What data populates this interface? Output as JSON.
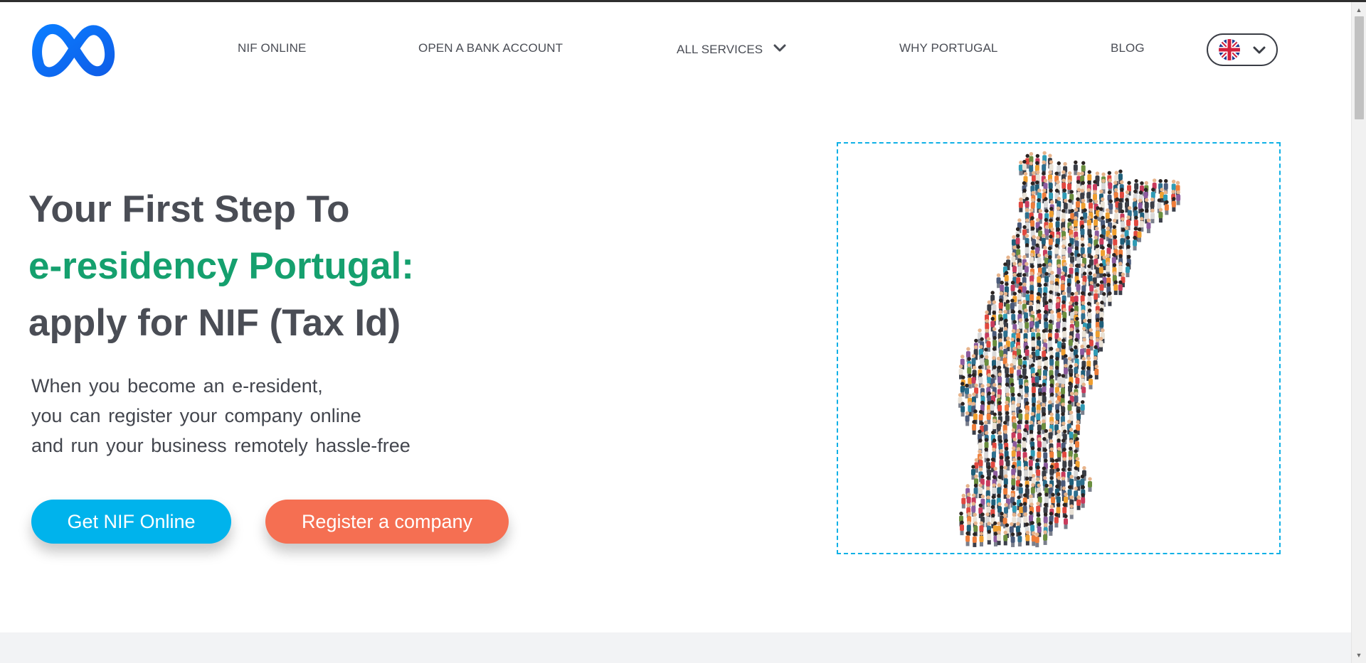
{
  "header": {
    "logo_icon": "meta-infinity-logo",
    "nav": [
      {
        "label": "NIF ONLINE"
      },
      {
        "label": "OPEN A BANK ACCOUNT"
      },
      {
        "label": "ALL SERVICES",
        "icon": "chevron-down-icon"
      },
      {
        "label": "WHY PORTUGAL"
      },
      {
        "label": "BLOG"
      }
    ],
    "language": {
      "icon": "uk-flag-icon",
      "selected": "EN"
    }
  },
  "hero": {
    "title_line1": "Your First Step To",
    "title_line2": "e-residency Portugal:",
    "title_line3": "apply for NIF (Tax Id)",
    "text_lines": [
      "When you become an e-resident,",
      "you can register your company online",
      "and run your business remotely hassle-free"
    ],
    "primary_button": "Get NIF Online",
    "secondary_button": "Register a company",
    "image_icon": "portugal-map-crowd-illustration"
  },
  "colors": {
    "accent_green": "#15a06e",
    "primary_blue": "#00b3ec",
    "secondary_orange": "#f56f52",
    "logo_blue": "#0a6cff",
    "text": "#4a4d55"
  }
}
